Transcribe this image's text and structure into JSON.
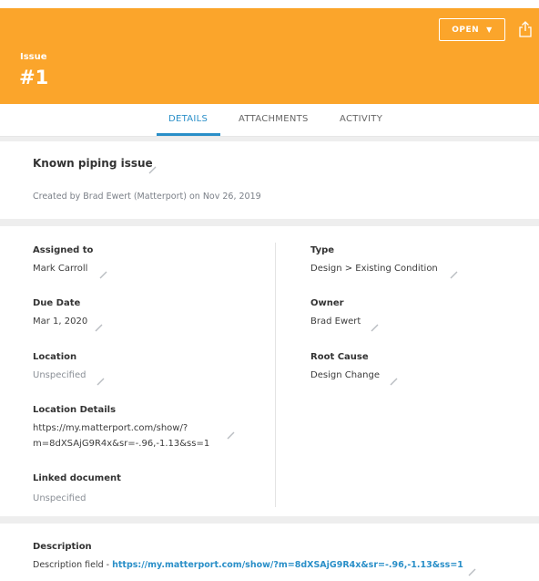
{
  "header": {
    "kind_label": "Issue",
    "issue_number": "#1",
    "status_label": "OPEN",
    "accent_color": "#fba52b"
  },
  "tabs": [
    {
      "label": "DETAILS",
      "active": true
    },
    {
      "label": "ATTACHMENTS",
      "active": false
    },
    {
      "label": "ACTIVITY",
      "active": false
    }
  ],
  "summary": {
    "title": "Known piping issue",
    "created_by": "Created by Brad Ewert (Matterport) on Nov 26, 2019"
  },
  "fields_left": [
    {
      "label": "Assigned to",
      "value": "Mark Carroll"
    },
    {
      "label": "Due Date",
      "value": "Mar 1, 2020"
    },
    {
      "label": "Location",
      "value": "Unspecified"
    },
    {
      "label": "Location Details",
      "value_line1": "https://my.matterport.com/show/?",
      "value_line2": "m=8dXSAjG9R4x&sr=-.96,-1.13&ss=1"
    },
    {
      "label": "Linked document",
      "value": "Unspecified"
    }
  ],
  "fields_right": [
    {
      "label": "Type",
      "value": "Design > Existing Condition"
    },
    {
      "label": "Owner",
      "value": "Brad Ewert"
    },
    {
      "label": "Root Cause",
      "value": "Design Change"
    }
  ],
  "description": {
    "label": "Description",
    "prefix": "Description field - ",
    "link": "https://my.matterport.com/show/?m=8dXSAjG9R4x&sr=-.96,-1.13&ss=1"
  },
  "icons": {
    "edit": "pencil-icon",
    "share": "share-icon",
    "dropdown": "caret-down-icon"
  }
}
